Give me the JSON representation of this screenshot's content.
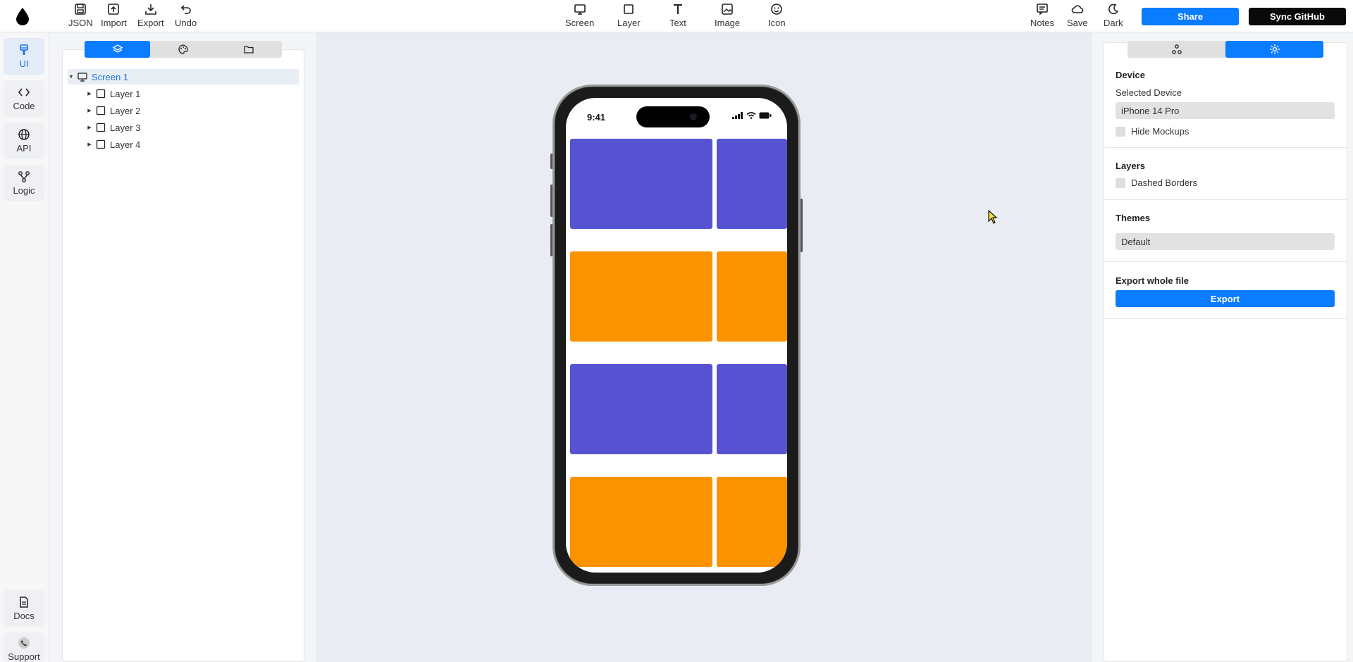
{
  "toolbar": {
    "left": [
      {
        "label": "JSON",
        "icon": "save-icon"
      },
      {
        "label": "Import",
        "icon": "import-icon"
      },
      {
        "label": "Export",
        "icon": "download-icon"
      },
      {
        "label": "Undo",
        "icon": "undo-icon"
      }
    ],
    "center": [
      {
        "label": "Screen",
        "icon": "monitor-icon"
      },
      {
        "label": "Layer",
        "icon": "square-icon"
      },
      {
        "label": "Text",
        "icon": "text-icon"
      },
      {
        "label": "Image",
        "icon": "image-icon"
      },
      {
        "label": "Icon",
        "icon": "smiley-icon"
      }
    ],
    "right": [
      {
        "label": "Notes",
        "icon": "notes-icon"
      },
      {
        "label": "Save",
        "icon": "cloud-icon"
      },
      {
        "label": "Dark",
        "icon": "moon-icon"
      }
    ],
    "share_label": "Share",
    "sync_label": "Sync GitHub"
  },
  "rail": {
    "items": [
      {
        "label": "UI",
        "icon": "brush-icon",
        "active": true
      },
      {
        "label": "Code",
        "icon": "code-icon"
      },
      {
        "label": "API",
        "icon": "globe-icon"
      },
      {
        "label": "Logic",
        "icon": "branch-icon"
      }
    ],
    "bottom": [
      {
        "label": "Docs",
        "icon": "document-icon"
      },
      {
        "label": "Support",
        "icon": "phone-icon"
      }
    ]
  },
  "layers_panel": {
    "tabs": [
      "layers-icon",
      "palette-icon",
      "folder-icon"
    ],
    "tree": [
      {
        "label": "Screen 1",
        "selected": true
      },
      {
        "label": "Layer 1"
      },
      {
        "label": "Layer 2"
      },
      {
        "label": "Layer 3"
      },
      {
        "label": "Layer 4"
      }
    ]
  },
  "phone": {
    "time": "9:41",
    "tile_colors": [
      "#5652d2",
      "#fb9300"
    ]
  },
  "settings": {
    "tabs": [
      "nodes-icon",
      "gear-icon"
    ],
    "device_title": "Device",
    "selected_device_label": "Selected Device",
    "selected_device_value": "iPhone 14 Pro",
    "hide_mockups_label": "Hide Mockups",
    "layers_title": "Layers",
    "dashed_borders_label": "Dashed Borders",
    "themes_title": "Themes",
    "theme_value": "Default",
    "export_title": "Export whole file",
    "export_label": "Export"
  },
  "colors": {
    "accent": "#0a7cff",
    "canvas_bg": "#e9edf3"
  }
}
